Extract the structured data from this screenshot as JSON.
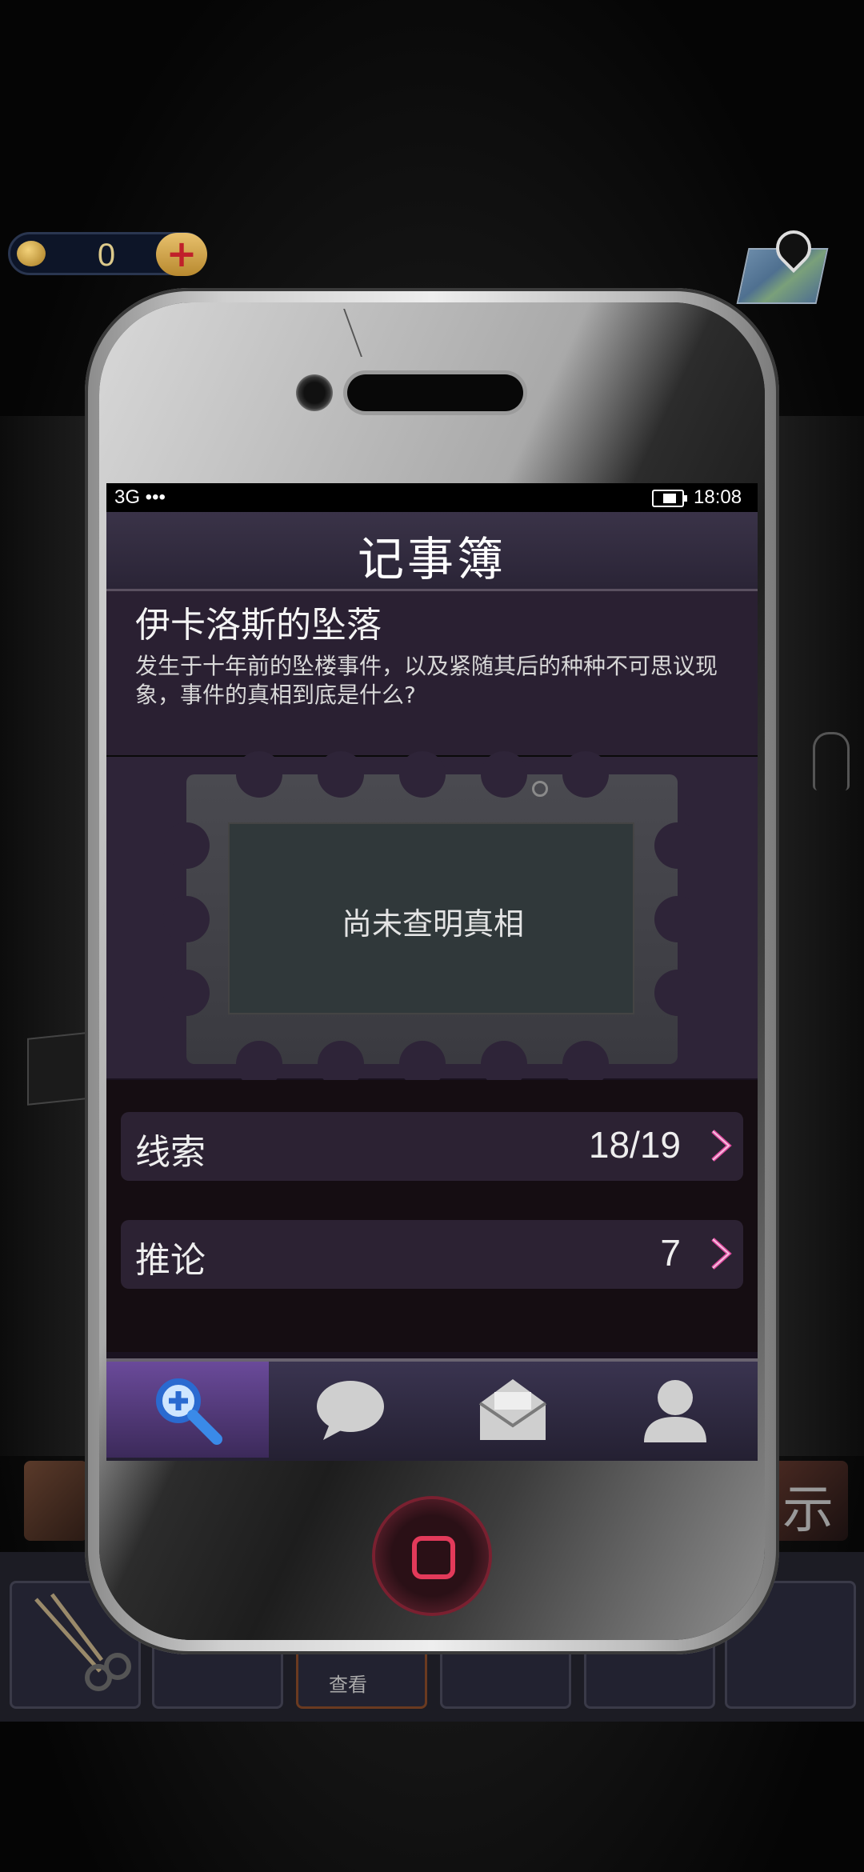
{
  "hud": {
    "coins": "0",
    "add_coins_symbol": "+",
    "coin_icon": "coin-icon",
    "map_icon": "map-icon"
  },
  "status_bar": {
    "network": "3G •••",
    "time": "18:08"
  },
  "notebook": {
    "title": "记事簿",
    "case_title": "伊卡洛斯的坠落",
    "case_description": "发生于十年前的坠楼事件，以及紧随其后的种种不可思议现象，事件的真相到底是什么?",
    "stamp_text": "尚未查明真相",
    "menu": [
      {
        "label": "线索",
        "value": "18/19"
      },
      {
        "label": "推论",
        "value": "7"
      }
    ],
    "tabs": [
      {
        "name": "search",
        "icon": "magnifier-icon",
        "active": true
      },
      {
        "name": "chat",
        "icon": "chat-bubble-icon",
        "active": false
      },
      {
        "name": "mail",
        "icon": "envelope-icon",
        "active": false
      },
      {
        "name": "profile",
        "icon": "person-icon",
        "active": false
      }
    ]
  },
  "inventory": {
    "view_label": "查看",
    "side_hint": "示"
  },
  "colors": {
    "accent_purple": "#6a4a9a",
    "home_button": "#e23a5a",
    "coin_gold": "#dcc98a"
  }
}
